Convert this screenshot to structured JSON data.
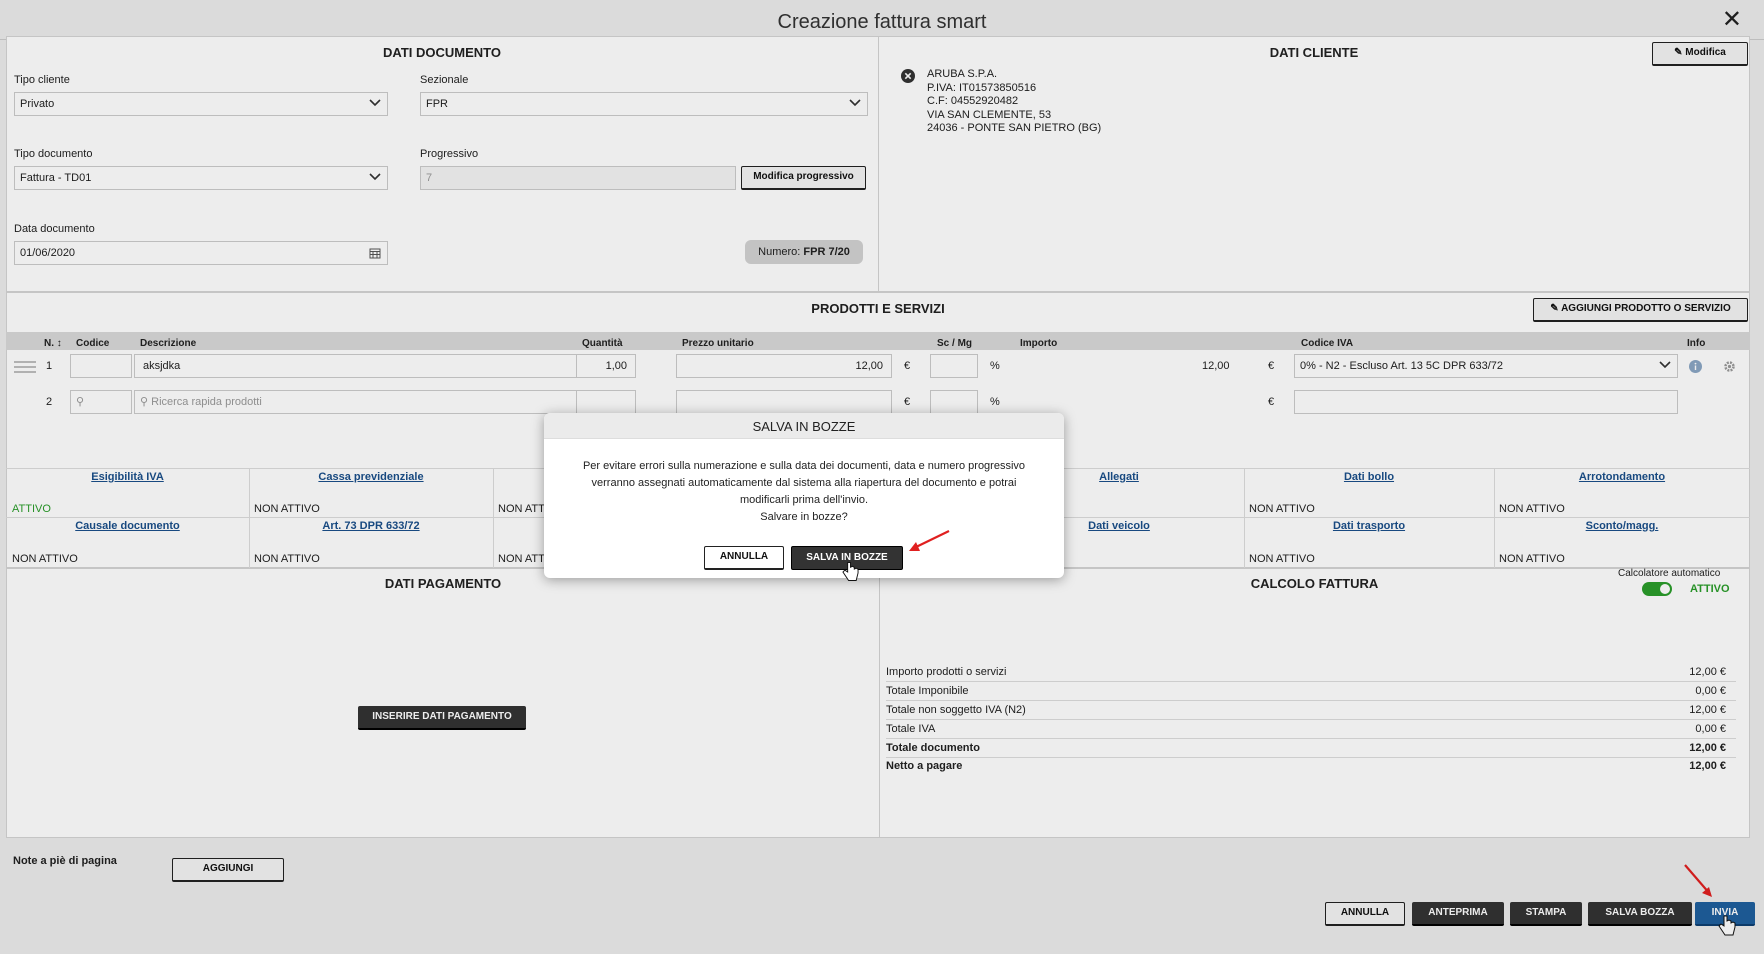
{
  "window": {
    "title": "Creazione fattura smart"
  },
  "dati_documento": {
    "title": "DATI DOCUMENTO",
    "tipo_cliente_label": "Tipo cliente",
    "tipo_cliente_value": "Privato",
    "sezionale_label": "Sezionale",
    "sezionale_value": "FPR",
    "tipo_documento_label": "Tipo documento",
    "tipo_documento_value": "Fattura - TD01",
    "progressivo_label": "Progressivo",
    "progressivo_value": "7",
    "modifica_progressivo": "Modifica progressivo",
    "data_documento_label": "Data documento",
    "data_documento_value": "01/06/2020",
    "numero_label": "Numero:",
    "numero_value": "FPR 7/20"
  },
  "dati_cliente": {
    "title": "DATI CLIENTE",
    "modifica": "Modifica",
    "lines": [
      "ARUBA S.P.A.",
      "P.IVA: IT01573850516",
      "C.F: 04552920482",
      "VIA SAN CLEMENTE, 53",
      "24036 - PONTE SAN PIETRO (BG)"
    ]
  },
  "prodotti": {
    "title": "PRODOTTI E SERVIZI",
    "add_button": "AGGIUNGI PRODOTTO O SERVIZIO",
    "headers": {
      "n": "N.",
      "codice": "Codice",
      "descrizione": "Descrizione",
      "quantita": "Quantità",
      "prezzo": "Prezzo unitario",
      "sconto": "Sc / Mg",
      "importo": "Importo",
      "codice_iva": "Codice IVA",
      "info": "Info"
    },
    "rows": [
      {
        "n": "1",
        "descrizione": "aksjdka",
        "quantita": "1,00",
        "prezzo": "12,00",
        "euro": "€",
        "pct": "%",
        "importo": "12,00",
        "iva": "0% - N2 - Escluso Art. 13 5C DPR 633/72"
      },
      {
        "n": "2",
        "placeholder": "Ricerca rapida prodotti",
        "euro": "€",
        "pct": "%"
      }
    ]
  },
  "opzioni": {
    "row1": [
      {
        "label": "Esigibilità IVA",
        "value": "ATTIVO"
      },
      {
        "label": "Cassa previdenziale",
        "value": "NON ATTIVO"
      },
      {
        "label": "",
        "value": "NON ATT"
      },
      {
        "label": "Allegati",
        "value": ""
      },
      {
        "label": "Dati bollo",
        "value": "NON ATTIVO"
      },
      {
        "label": "Arrotondamento",
        "value": "NON ATTIVO"
      }
    ],
    "row2": [
      {
        "label": "Causale documento",
        "value": "NON ATTIVO"
      },
      {
        "label": "Art. 73 DPR 633/72",
        "value": "NON ATTIVO"
      },
      {
        "label": "",
        "value": "NON ATT"
      },
      {
        "label": "Dati veicolo",
        "value": ""
      },
      {
        "label": "Dati trasporto",
        "value": "NON ATTIVO"
      },
      {
        "label": "Sconto/magg.",
        "value": "NON ATTIVO"
      }
    ]
  },
  "pagamento": {
    "title": "DATI PAGAMENTO",
    "button": "INSERIRE DATI PAGAMENTO"
  },
  "calcolo": {
    "title": "CALCOLO FATTURA",
    "auto_label": "Calcolatore automatico",
    "auto_state": "ATTIVO",
    "rows": [
      {
        "label": "Importo prodotti o servizi",
        "value": "12,00  €"
      },
      {
        "label": "Totale Imponibile",
        "value": "0,00  €"
      },
      {
        "label": "Totale non soggetto IVA (N2)",
        "value": "12,00  €"
      },
      {
        "label": "Totale IVA",
        "value": "0,00  €"
      },
      {
        "label": "Totale documento",
        "value": "12,00  €"
      },
      {
        "label": "Netto a pagare",
        "value": "12,00  €"
      }
    ]
  },
  "note": {
    "label": "Note a piè di pagina",
    "button": "AGGIUNGI"
  },
  "footer": {
    "annulla": "ANNULLA",
    "anteprima": "ANTEPRIMA",
    "stampa": "STAMPA",
    "salva_bozza": "SALVA BOZZA",
    "invia": "INVIA"
  },
  "modal": {
    "title": "SALVA IN BOZZE",
    "line1": "Per evitare errori sulla numerazione e sulla data dei documenti, data e numero progressivo",
    "line2": "verranno assegnati automaticamente dal sistema alla riapertura del documento e potrai",
    "line3": "modificarli prima dell'invio.",
    "line4": "Salvare in bozze?",
    "cancel": "ANNULLA",
    "confirm": "SALVA IN BOZZE"
  },
  "colors": {
    "accent_blue": "#1f5f9e",
    "active_green": "#2a9d2a",
    "link_blue": "#1a4f8a",
    "annotation_red": "#e02020"
  }
}
